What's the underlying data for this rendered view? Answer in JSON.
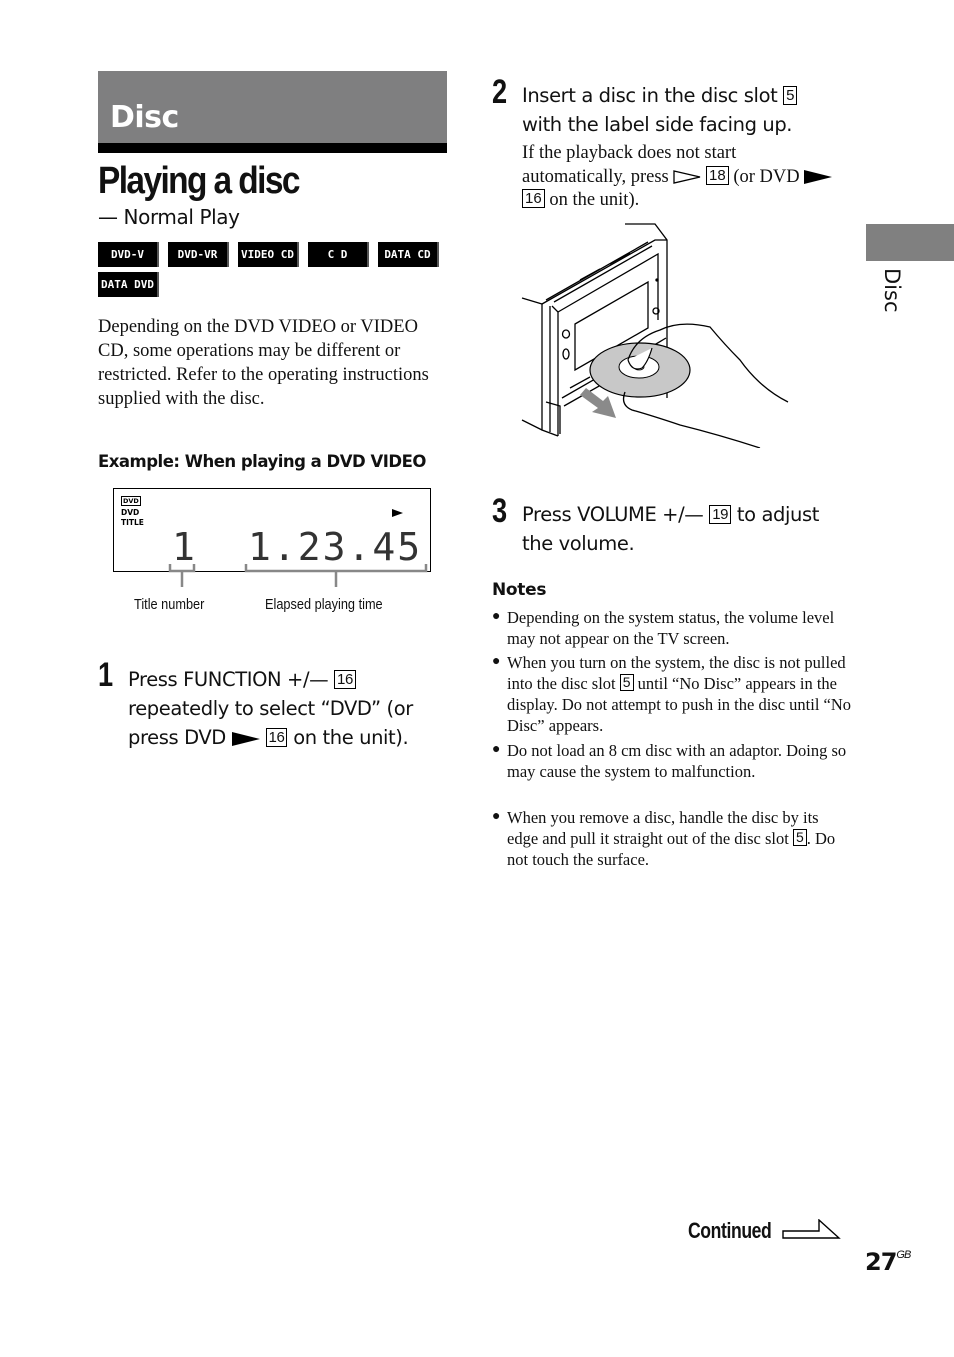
{
  "section": {
    "band_title": "Disc",
    "side_tab_label": "Disc"
  },
  "title": {
    "main": "Playing a disc",
    "subtitle": "— Normal Play"
  },
  "disc_badges": [
    "DVD-V",
    "DVD-VR",
    "VIDEO CD",
    "C D",
    "DATA CD",
    "DATA DVD"
  ],
  "intro": "Depending on the DVD VIDEO or VIDEO CD, some operations may be different or restricted. Refer to the operating instructions supplied with the disc.",
  "example": {
    "label": "Example: When playing a DVD VIDEO",
    "display": {
      "indicator_logo": "DVD",
      "indicator_lines": [
        "DVD",
        "TITLE"
      ],
      "title_number": "1",
      "elapsed_time": "1.23.45",
      "play_icon": "play-icon"
    },
    "callouts": {
      "title_number": "Title number",
      "elapsed_time": "Elapsed playing time"
    }
  },
  "steps": [
    {
      "number": "1",
      "parts": [
        "Press FUNCTION +/— ",
        "16",
        " repeatedly to select “DVD” (or press DVD ",
        "16",
        " on the unit)."
      ]
    },
    {
      "number": "2",
      "main": [
        "Insert a disc in the disc slot ",
        "5",
        " with the label side facing up."
      ],
      "detail": [
        "If the playback does not start automatically, press ",
        "18",
        " (or DVD ",
        "16",
        " on the unit)."
      ]
    },
    {
      "number": "3",
      "parts": [
        "Press VOLUME +/— ",
        "19",
        " to adjust the volume."
      ]
    }
  ],
  "notes": {
    "heading": "Notes",
    "items": [
      {
        "text": "Depending on the system status, the volume level may not appear on the TV screen."
      },
      {
        "before": "When you turn on the system, the disc is not pulled into the disc slot ",
        "ref": "5",
        "after": " until “No Disc” appears in the display. Do not attempt to push in the disc until “No Disc” appears."
      },
      {
        "text": "Do not load an 8 cm disc with an adaptor. Doing so may cause the system to malfunction."
      },
      {
        "before": "When you remove a disc, handle the disc by its edge and pull it straight out of the disc slot ",
        "ref": "5",
        "after": ". Do not touch the surface."
      }
    ]
  },
  "footer": {
    "continued": "Continued",
    "page_number": "27",
    "page_suffix": "GB"
  }
}
